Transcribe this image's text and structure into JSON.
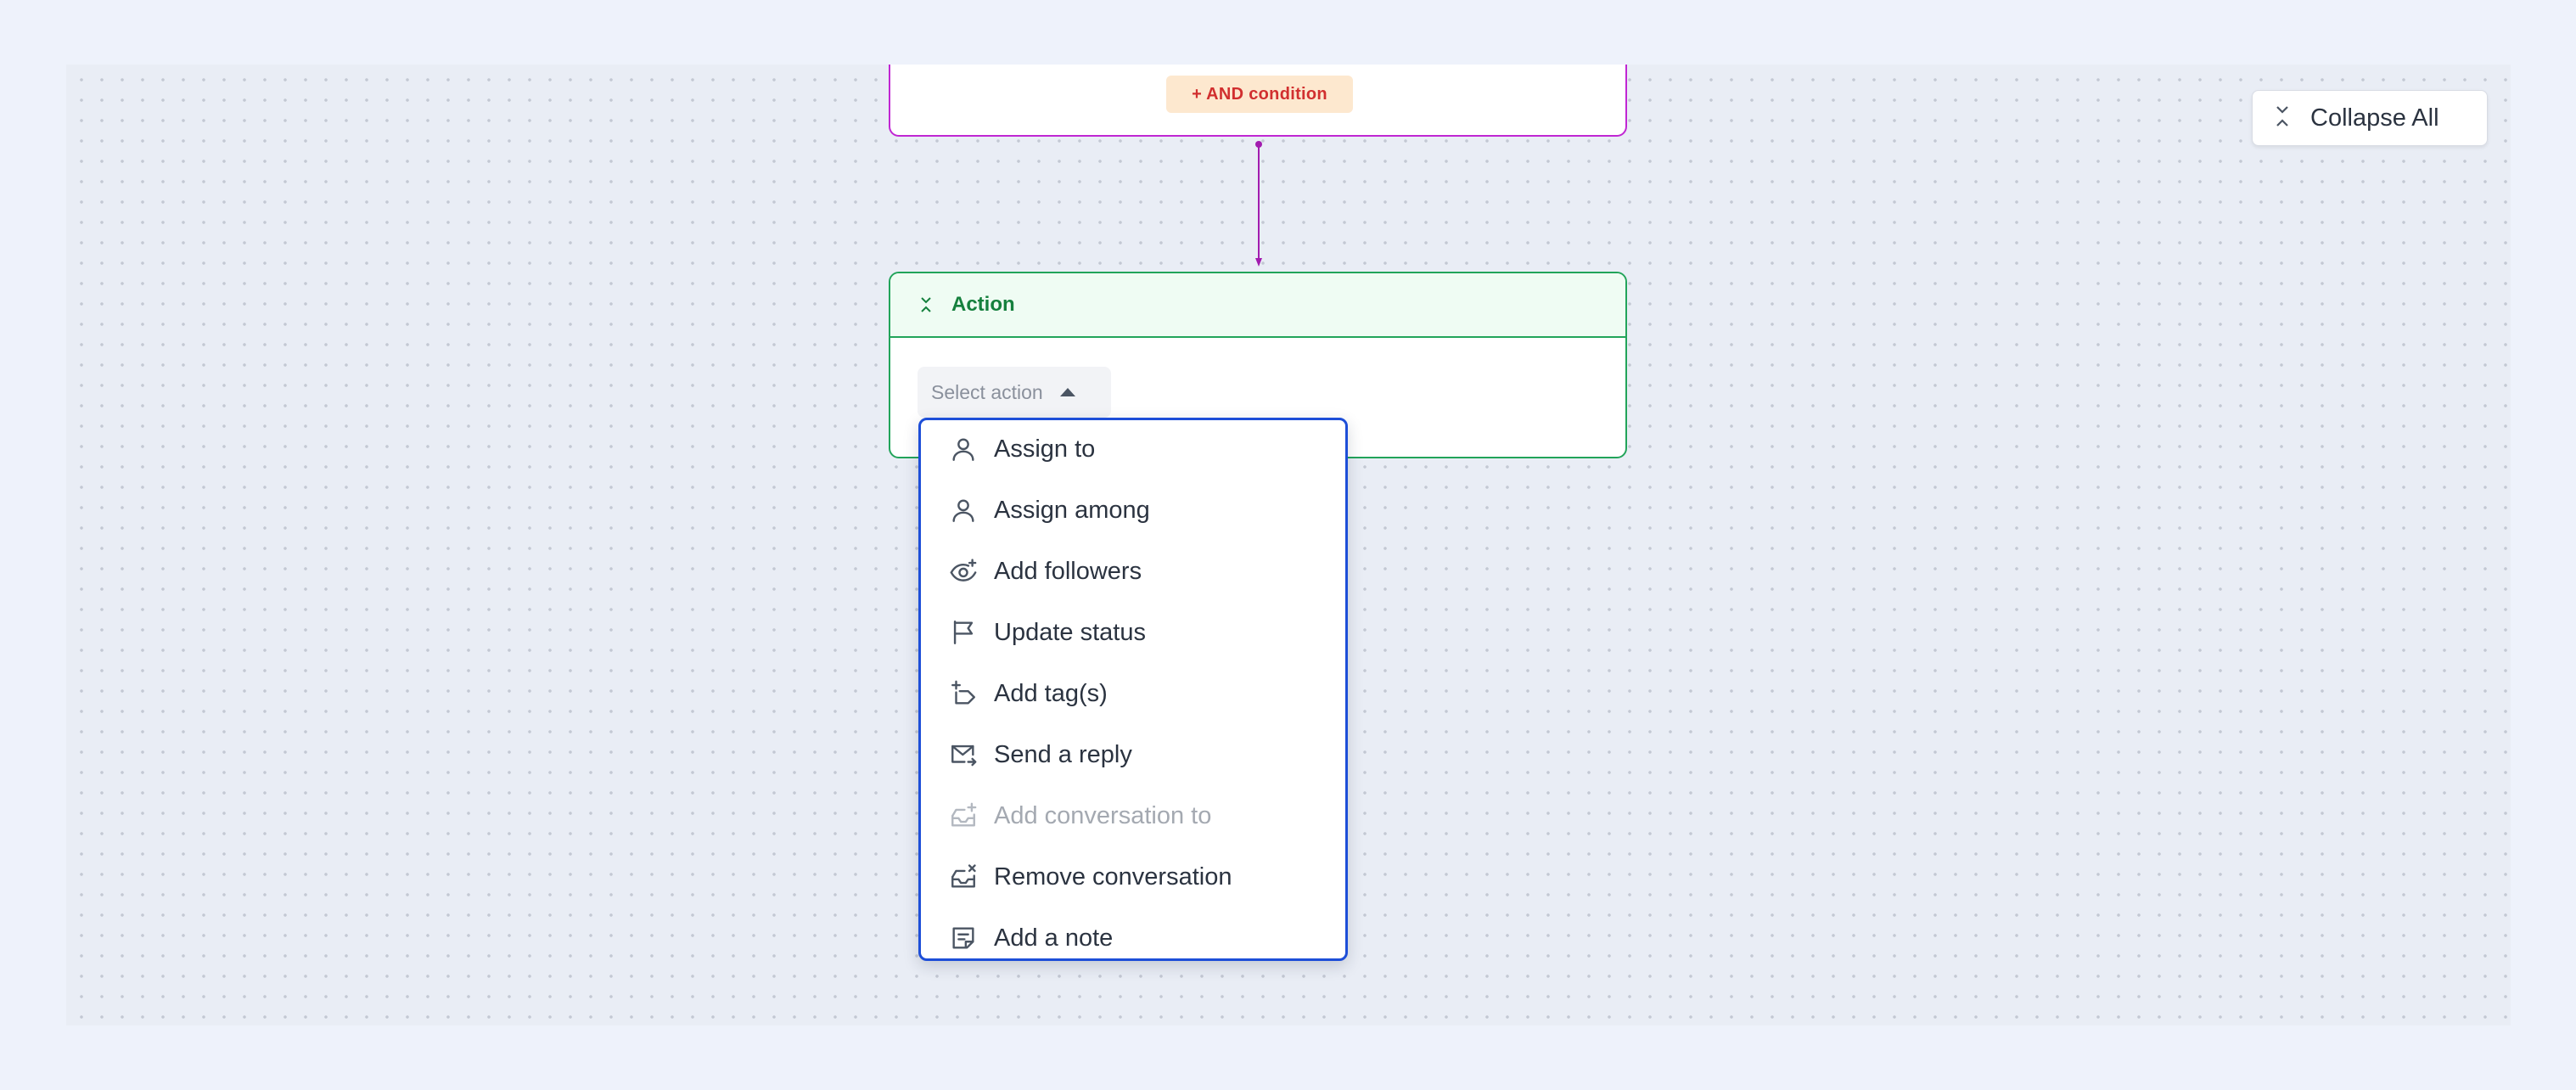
{
  "condition_card": {
    "and_button_label": "+ AND condition"
  },
  "action_card": {
    "title": "Action",
    "select_placeholder": "Select action"
  },
  "dropdown": {
    "items": [
      {
        "label": "Assign to",
        "icon": "user-icon",
        "disabled": false
      },
      {
        "label": "Assign among",
        "icon": "user-icon",
        "disabled": false
      },
      {
        "label": "Add followers",
        "icon": "eye-plus-icon",
        "disabled": false
      },
      {
        "label": "Update status",
        "icon": "flag-icon",
        "disabled": false
      },
      {
        "label": "Add tag(s)",
        "icon": "tag-plus-icon",
        "disabled": false
      },
      {
        "label": "Send a reply",
        "icon": "mail-forward-icon",
        "disabled": false
      },
      {
        "label": "Add conversation to",
        "icon": "inbox-plus-icon",
        "disabled": true
      },
      {
        "label": "Remove conversation",
        "icon": "inbox-remove-icon",
        "disabled": false
      },
      {
        "label": "Add a note",
        "icon": "note-icon",
        "disabled": false
      }
    ]
  },
  "toolbar": {
    "collapse_all_label": "Collapse All"
  },
  "colors": {
    "condition_border": "#c026d3",
    "action_border": "#22a45a",
    "dropdown_border": "#1d4ed8",
    "and_button_bg": "#fde8cf",
    "and_button_text": "#d12f2f"
  }
}
